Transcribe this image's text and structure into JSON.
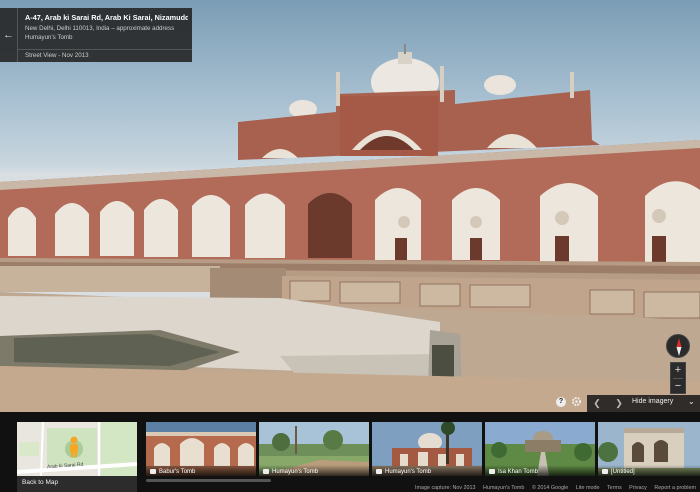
{
  "address": {
    "title": "A-47, Arab ki Sarai Rd, Arab Ki Sarai, Nizamuddin East",
    "subtitle": "New Delhi, Delhi 110013, India – approximate address",
    "place": "Humayun's Tomb",
    "street_view_date": "Street View - Nov 2013",
    "back_icon": "back-arrow-icon"
  },
  "controls": {
    "help_label": "?",
    "zoom_in_label": "+",
    "zoom_out_label": "−",
    "prev_label": "❮",
    "next_label": "❯",
    "hide_imagery_label": "Hide imagery",
    "hide_arrow": "⌄"
  },
  "map": {
    "road_label": "Arab ki Sarai Rd",
    "back_to_map_label": "Back to Map"
  },
  "thumbnails": [
    {
      "label": "Babur's Tomb"
    },
    {
      "label": "Humayun's Tomb"
    },
    {
      "label": "Humayun's Tomb"
    },
    {
      "label": "Isa Khan Tomb"
    },
    {
      "label": "[Untitled]"
    }
  ],
  "footer": {
    "image_capture": "Image capture: Nov 2013",
    "place": "Humayun's Tomb",
    "copyright": "© 2014 Google",
    "lite_mode": "Lite mode",
    "terms": "Terms",
    "privacy": "Privacy",
    "report": "Report a problem"
  },
  "colors": {
    "sandstone": "#a85a47",
    "marble": "#e8e3da",
    "ui_dark": "#222222"
  }
}
